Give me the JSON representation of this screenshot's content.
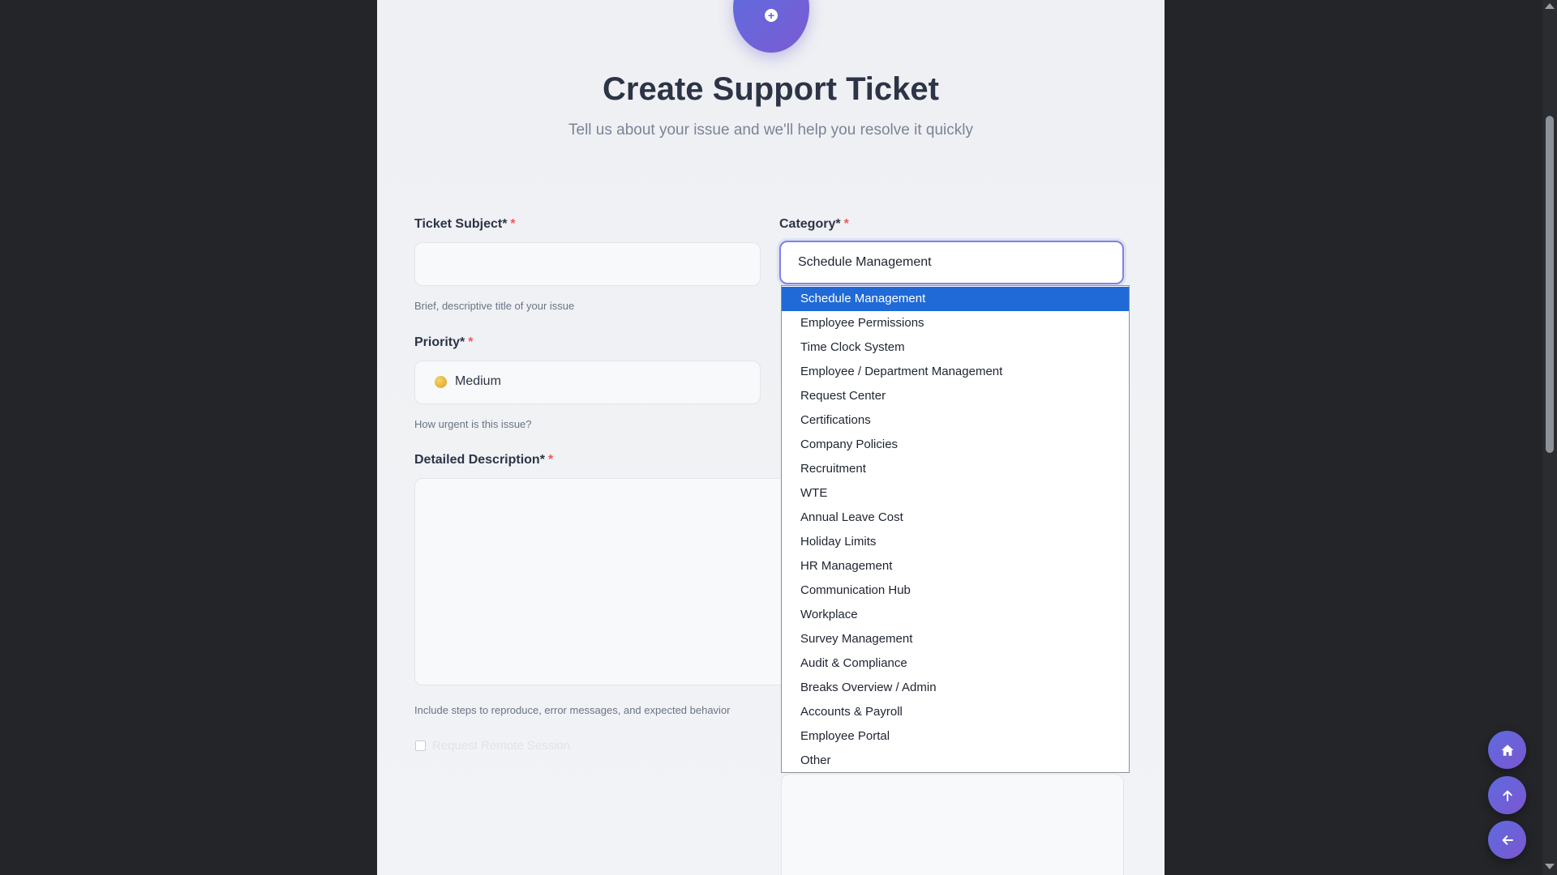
{
  "header": {
    "title": "Create Support Ticket",
    "subtitle": "Tell us about your issue and we'll help you resolve it quickly"
  },
  "form": {
    "subject": {
      "label": "Ticket Subject*",
      "required_mark": "*",
      "value": "",
      "hint": "Brief, descriptive title of your issue"
    },
    "category": {
      "label": "Category*",
      "required_mark": "*",
      "selected": "Schedule Management",
      "options": [
        "Schedule Management",
        "Employee Permissions",
        "Time Clock System",
        "Employee / Department Management",
        "Request Center",
        "Certifications",
        "Company Policies",
        "Recruitment",
        "WTE",
        "Annual Leave Cost",
        "Holiday Limits",
        "HR Management",
        "Communication Hub",
        "Workplace",
        "Survey Management",
        "Audit & Compliance",
        "Breaks Overview / Admin",
        "Accounts & Payroll",
        "Employee Portal",
        "Other"
      ]
    },
    "priority": {
      "label": "Priority*",
      "required_mark": "*",
      "value": "Medium",
      "hint": "How urgent is this issue?"
    },
    "description": {
      "label": "Detailed Description*",
      "required_mark": "*",
      "value": "",
      "hint": "Include steps to reproduce, error messages, and expected behavior"
    },
    "remote_session": {
      "label": "Request Remote Session",
      "checked": false
    }
  },
  "icons": {
    "hero": "plus-circle-icon",
    "home": "home-icon",
    "scroll_top": "arrow-up-icon",
    "back": "arrow-left-icon"
  },
  "colors": {
    "accent": "#6a63d8",
    "selected_option": "#1f6ad6",
    "required": "#ef5a5a",
    "background": "#232528"
  }
}
